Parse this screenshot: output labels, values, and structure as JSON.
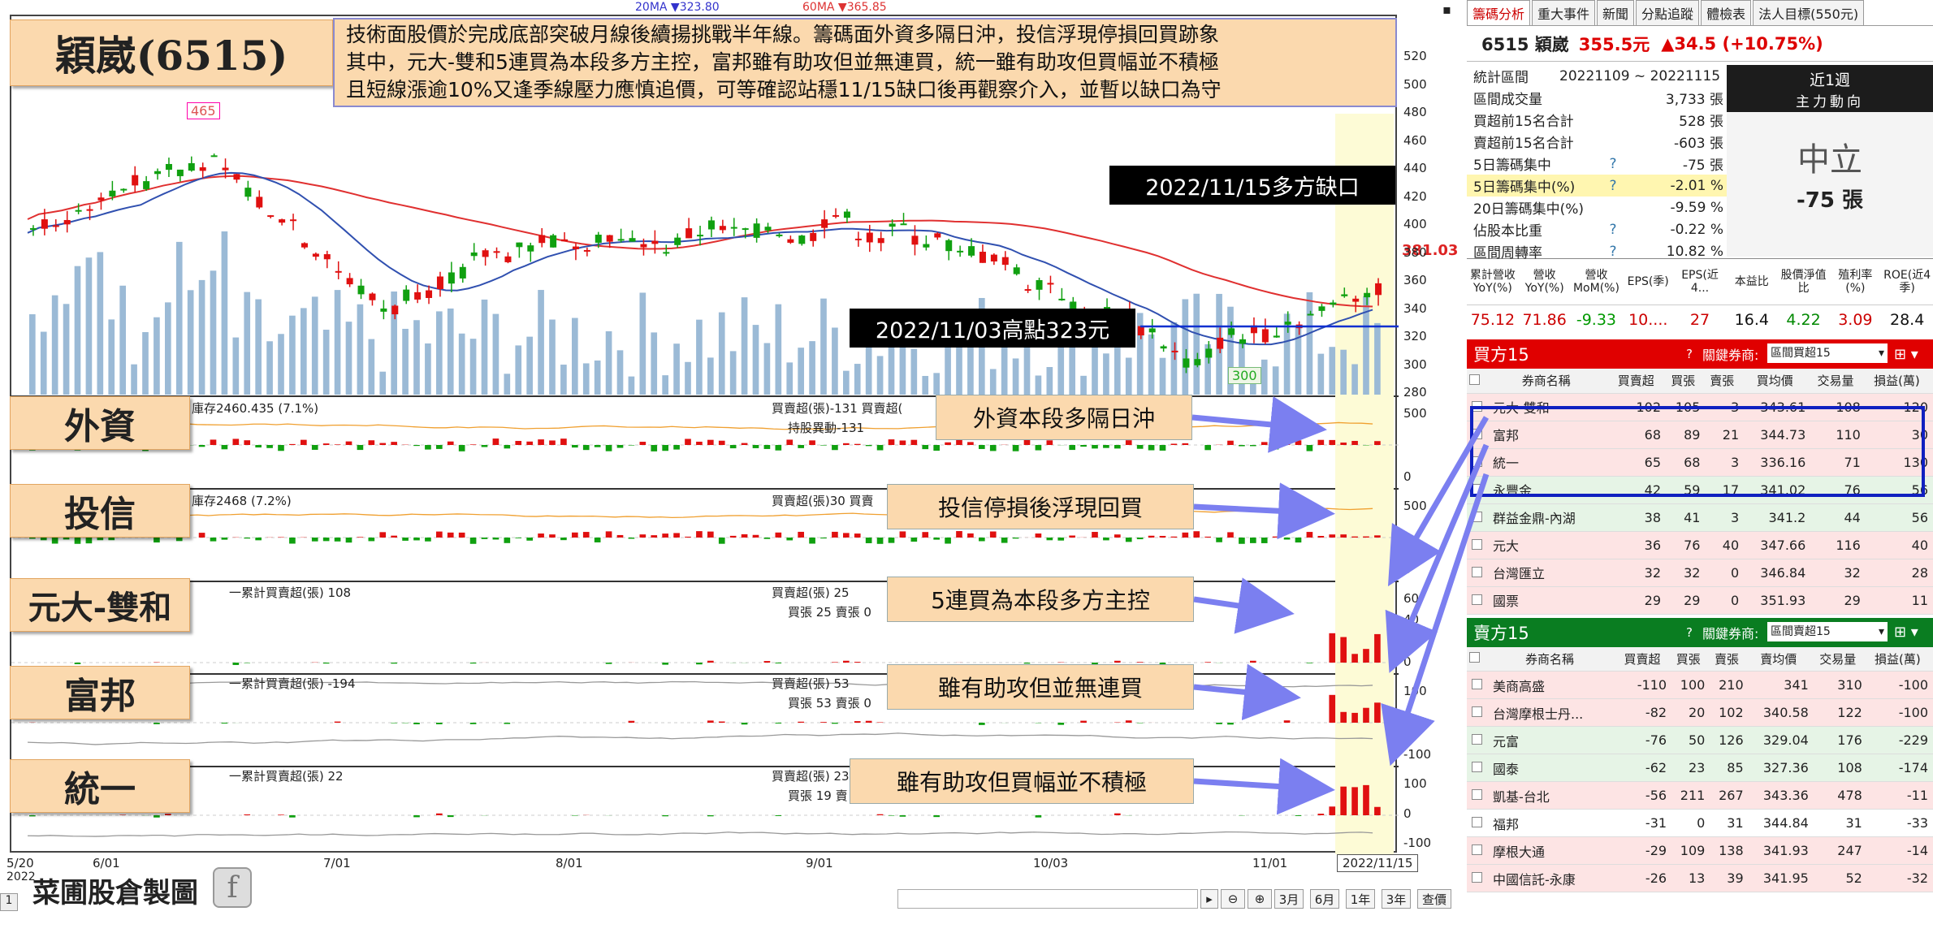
{
  "stock": {
    "title": "穎崴(6515)",
    "code_name": "6515 穎崴",
    "price": "355.5元",
    "change": "▲34.5 (+10.75%)"
  },
  "legend": {
    "ma20": "20MA ▼323.80",
    "ma60": "60MA ▼365.85"
  },
  "commentary": [
    "技術面股價於完成底部突破月線後續揚挑戰半年線。籌碼面外資多隔日沖，投信浮現停損回買跡象",
    "其中，元大-雙和5連買為本段多方主控，富邦雖有助攻但並無連買，統一雖有助攻但買幅並不積極",
    "且短線漲逾10%又逢季線壓力應慎追價，可等確認站穩11/15缺口後再觀察介入，並暫以缺口為守"
  ],
  "annotations": {
    "gap": "2022/11/15多方缺口",
    "high": "2022/11/03高點323元",
    "peak": "465",
    "low": "300",
    "last_price": "381.03"
  },
  "price_axis": [
    "520",
    "500",
    "480",
    "460",
    "440",
    "420",
    "400",
    "380",
    "360",
    "340",
    "320",
    "300",
    "280"
  ],
  "panels": [
    {
      "label": "外資",
      "info1": "庫存2460.435 (7.1%)",
      "info2": "買賣超(張)-131 買賣超(",
      "info3": "持股異動-131",
      "callout": "外資本段多隔日沖",
      "axis": [
        "500",
        "0"
      ]
    },
    {
      "label": "投信",
      "info1": "庫存2468 (7.2%)",
      "info2": "買賣超(張)30 買賣",
      "info3": "",
      "callout": "投信停損後浮現回買",
      "axis": [
        "500",
        "0"
      ]
    },
    {
      "label": "元大-雙和",
      "info1": "一累計買賣超(張) 108",
      "info2": "買賣超(張) 25",
      "info3": "買張 25 賣張 0",
      "callout": "5連買為本段多方主控",
      "axis": [
        "60",
        "40",
        "20",
        "0"
      ]
    },
    {
      "label": "富邦",
      "info1": "一累計買賣超(張) -194",
      "info2": "買賣超(張) 53",
      "info3": "買張 53 賣張 0",
      "callout": "雖有助攻但並無連買",
      "axis": [
        "100",
        "0",
        "-100"
      ]
    },
    {
      "label": "統一",
      "info1": "一累計買賣超(張) 22",
      "info2": "買賣超(張) 23",
      "info3": "買張 19 賣",
      "callout": "雖有助攻但買幅並不積極",
      "axis": [
        "100",
        "0",
        "-100"
      ]
    }
  ],
  "dates": [
    "5/20",
    "6/01",
    "7/01",
    "8/01",
    "9/01",
    "10/03",
    "11/01"
  ],
  "year": "2022",
  "date_tag": "2022/11/15",
  "watermark": "菜圃股倉製圖",
  "bottom_buttons": [
    "3月",
    "6月",
    "1年",
    "3年",
    "查價"
  ],
  "right": {
    "tabs": [
      "籌碼分析",
      "重大事件",
      "新聞",
      "分點追蹤",
      "體檢表",
      "法人目標(550元)"
    ],
    "stats": [
      {
        "k": "統計區間",
        "v": "20221109 ~ 20221115",
        "q": ""
      },
      {
        "k": "區間成交量",
        "v": "3,733 張",
        "q": ""
      },
      {
        "k": "買超前15名合計",
        "v": "528 張",
        "q": ""
      },
      {
        "k": "賣超前15名合計",
        "v": "-603 張",
        "q": ""
      },
      {
        "k": "5日籌碼集中",
        "v": "-75 張",
        "q": "?"
      },
      {
        "k": "5日籌碼集中(%)",
        "v": "-2.01 %",
        "q": "?"
      },
      {
        "k": "20日籌碼集中(%)",
        "v": "-9.59 %",
        "q": ""
      },
      {
        "k": "佔股本比重",
        "v": "-0.22 %",
        "q": "?"
      },
      {
        "k": "區間周轉率",
        "v": "10.82 %",
        "q": "?"
      }
    ],
    "period": "近1週",
    "flow_title": "主力動向",
    "flow_status": "中立",
    "flow_value": "-75 張",
    "fin_head": [
      "累計營收YoY(%)",
      "營收YoY(%)",
      "營收MoM(%)",
      "EPS(季)",
      "EPS(近4...",
      "本益比",
      "股價淨值比",
      "殖利率(%)",
      "ROE(近4季)"
    ],
    "fin_vals": [
      "75.12",
      "71.86",
      "-9.33",
      "10....",
      "27",
      "16.4",
      "4.22",
      "3.09",
      "28.4"
    ],
    "buy_title": "買方15",
    "sell_title": "賣方15",
    "broker_lbl": "關鍵券商:",
    "buy_select": "區間買超15",
    "sell_select": "區間賣超15",
    "cols_buy": [
      "券商名稱",
      "買賣超",
      "買張",
      "賣張",
      "買均價",
      "交易量",
      "損益(萬)"
    ],
    "cols_sell": [
      "券商名稱",
      "買賣超",
      "買張",
      "賣張",
      "賣均價",
      "交易量",
      "損益(萬)"
    ],
    "buy_rows": [
      [
        "元大-雙和",
        "102",
        "105",
        "3",
        "343.61",
        "108",
        "120"
      ],
      [
        "富邦",
        "68",
        "89",
        "21",
        "344.73",
        "110",
        "30"
      ],
      [
        "統一",
        "65",
        "68",
        "3",
        "336.16",
        "71",
        "130"
      ],
      [
        "永豐金",
        "42",
        "59",
        "17",
        "341.02",
        "76",
        "56"
      ],
      [
        "群益金鼎-內湖",
        "38",
        "41",
        "3",
        "341.2",
        "44",
        "56"
      ],
      [
        "元大",
        "36",
        "76",
        "40",
        "347.66",
        "116",
        "40"
      ],
      [
        "台灣匯立",
        "32",
        "32",
        "0",
        "346.84",
        "32",
        "28"
      ],
      [
        "國票",
        "29",
        "29",
        "0",
        "351.93",
        "29",
        "11"
      ]
    ],
    "sell_rows": [
      [
        "美商高盛",
        "-110",
        "100",
        "210",
        "341",
        "310",
        "-100"
      ],
      [
        "台灣摩根士丹...",
        "-82",
        "20",
        "102",
        "340.58",
        "122",
        "-100"
      ],
      [
        "元富",
        "-76",
        "50",
        "126",
        "329.04",
        "176",
        "-229"
      ],
      [
        "國泰",
        "-62",
        "23",
        "85",
        "327.36",
        "108",
        "-174"
      ],
      [
        "凱基-台北",
        "-56",
        "211",
        "267",
        "343.36",
        "478",
        "-11"
      ],
      [
        "福邦",
        "-31",
        "0",
        "31",
        "344.84",
        "31",
        "-33"
      ],
      [
        "摩根大通",
        "-29",
        "109",
        "138",
        "341.93",
        "247",
        "-14"
      ],
      [
        "中國信託-永康",
        "-26",
        "13",
        "39",
        "341.95",
        "52",
        "-32"
      ]
    ]
  }
}
